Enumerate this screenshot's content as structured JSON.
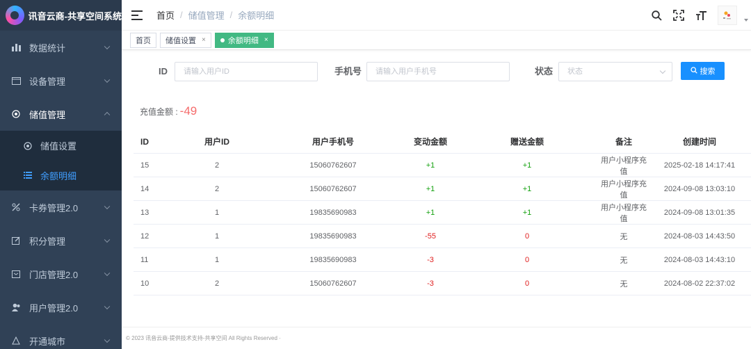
{
  "app": {
    "title": "讯音云商-共享空间系统"
  },
  "sidebar": {
    "items": [
      {
        "label": "数据统计",
        "icon": "bar-chart-icon"
      },
      {
        "label": "设备管理",
        "icon": "calendar-icon"
      },
      {
        "label": "储值管理",
        "icon": "target-icon",
        "open": true,
        "children": [
          {
            "label": "储值设置",
            "icon": "target-icon"
          },
          {
            "label": "余额明细",
            "icon": "list-icon",
            "active": true
          }
        ]
      },
      {
        "label": "卡券管理2.0",
        "icon": "coupon-icon"
      },
      {
        "label": "积分管理",
        "icon": "edit-icon"
      },
      {
        "label": "门店管理2.0",
        "icon": "store-icon"
      },
      {
        "label": "用户管理2.0",
        "icon": "users-icon"
      },
      {
        "label": "开通城市",
        "icon": "city-icon"
      }
    ]
  },
  "header": {
    "breadcrumb": [
      "首页",
      "储值管理",
      "余额明细"
    ],
    "icons": [
      "search-icon",
      "fullscreen-icon",
      "font-size-icon"
    ]
  },
  "tags": [
    {
      "label": "首页",
      "closable": false,
      "active": false
    },
    {
      "label": "储值设置",
      "closable": true,
      "active": false
    },
    {
      "label": "余额明细",
      "closable": true,
      "active": true
    }
  ],
  "filter": {
    "id_label": "ID",
    "id_placeholder": "请输入用户ID",
    "phone_label": "手机号",
    "phone_placeholder": "请输入用户手机号",
    "status_label": "状态",
    "status_placeholder": "状态",
    "search_label": "搜索"
  },
  "summary": {
    "label": "充值金额 :",
    "value": "-49"
  },
  "table": {
    "columns": [
      "ID",
      "用户ID",
      "用户手机号",
      "变动金额",
      "赠送金额",
      "备注",
      "创建时间"
    ],
    "rows": [
      [
        "15",
        "2",
        "15060762607",
        "+1",
        "+1",
        "用户小程序充值",
        "2025-02-18 14:17:41"
      ],
      [
        "14",
        "2",
        "15060762607",
        "+1",
        "+1",
        "用户小程序充值",
        "2024-09-08 13:03:10"
      ],
      [
        "13",
        "1",
        "19835690983",
        "+1",
        "+1",
        "用户小程序充值",
        "2024-09-08 13:01:35"
      ],
      [
        "12",
        "1",
        "19835690983",
        "-55",
        "0",
        "无",
        "2024-08-03 14:43:50"
      ],
      [
        "11",
        "1",
        "19835690983",
        "-3",
        "0",
        "无",
        "2024-08-03 14:43:10"
      ],
      [
        "10",
        "2",
        "15060762607",
        "-3",
        "0",
        "无",
        "2024-08-02 22:37:02"
      ]
    ]
  },
  "footer": {
    "text": "© 2023 讯音云商-提供技术支持-共享空间 All Rights Reserved ·"
  },
  "colors": {
    "sidebar_bg": "#304156",
    "accent": "#409eff",
    "tag_active": "#42b983",
    "positive": "#13a10e",
    "negative": "#e02020"
  }
}
